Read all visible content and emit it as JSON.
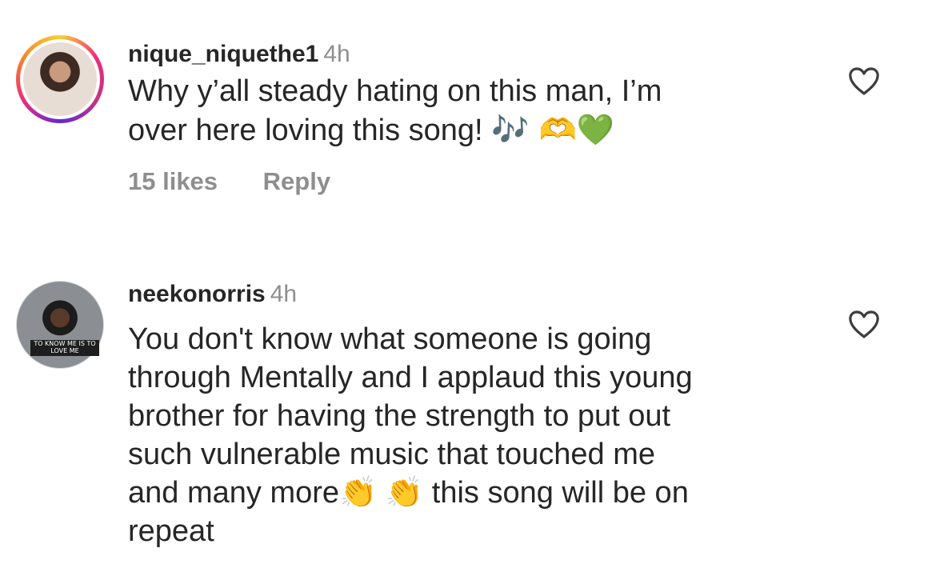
{
  "comments": [
    {
      "username": "nique_niquethe1",
      "time": "4h",
      "text": "Why y’all steady hating on this man, I’m",
      "text_line2": "over here loving this song! ",
      "emojis": "🎶 🫶💚",
      "likes": "15 likes",
      "reply": "Reply",
      "icons": [
        "avatar",
        "heart-outline-icon"
      ]
    },
    {
      "username": "neekonorris",
      "time": "4h",
      "avatar_caption": "TO KNOW ME IS TO LOVE ME",
      "lines": [
        "You don't know what someone is going",
        "through Mentally and I applaud this young",
        "brother for having the strength to put out",
        "such vulnerable music that touched me",
        "and many more👏 👏 this song will be on",
        "repeat"
      ],
      "icons": [
        "avatar",
        "heart-outline-icon"
      ]
    }
  ],
  "colors": {
    "text": "#262626",
    "secondary": "#8e8e8e",
    "background": "#ffffff"
  }
}
